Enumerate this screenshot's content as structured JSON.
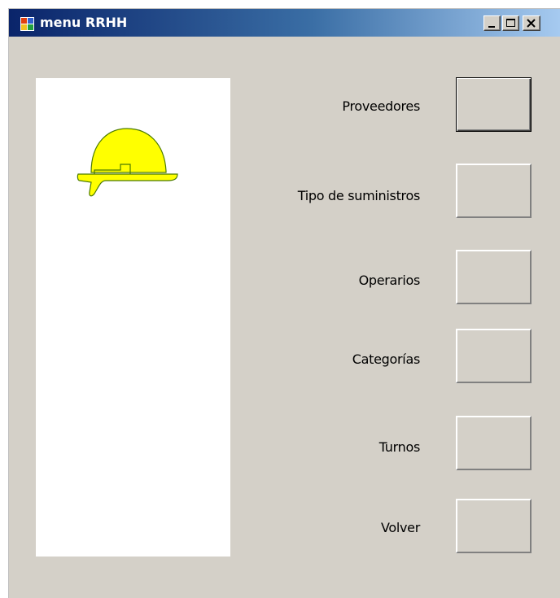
{
  "window": {
    "title": "menu RRHH"
  },
  "panel": {
    "image_icon": "hard-hat-icon"
  },
  "menu": {
    "items": [
      {
        "label": "Proveedores"
      },
      {
        "label": "Tipo de suministros"
      },
      {
        "label": "Operarios"
      },
      {
        "label": "Categorías"
      },
      {
        "label": "Turnos"
      },
      {
        "label": "Volver"
      }
    ]
  },
  "colors": {
    "titlebar_start": "#0a246a",
    "titlebar_end": "#a6caf0",
    "face": "#d4d0c8",
    "helmet": "#ffff00"
  }
}
